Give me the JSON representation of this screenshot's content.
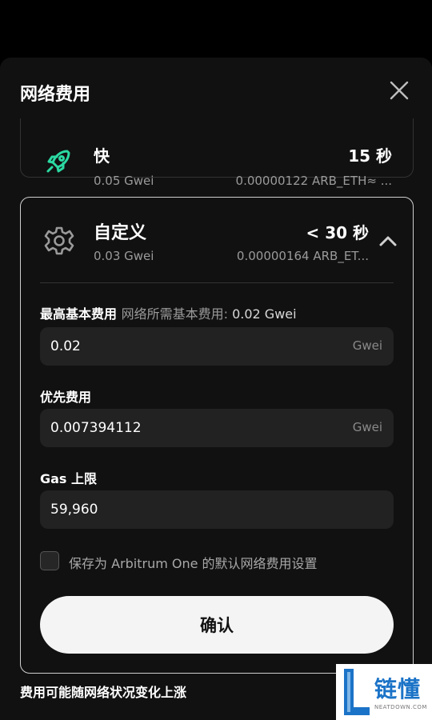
{
  "header": {
    "title": "网络费用"
  },
  "fast_option": {
    "name": "快",
    "time": "15 秒",
    "gwei": "0.05 Gwei",
    "amount": "0.00000122 ARB_ETH≈ ...",
    "icon": "rocket-icon",
    "icon_color": "#2bd9a2"
  },
  "custom_option": {
    "name": "自定义",
    "time": "< 30 秒",
    "gwei": "0.03 Gwei",
    "amount": "0.00000164 ARB_ET...",
    "icon": "gear-icon",
    "expanded": true,
    "max_base_fee": {
      "label": "最高基本费用",
      "hint": "网络所需基本费用:",
      "hint_value": "0.02 Gwei",
      "value": "0.02",
      "unit": "Gwei"
    },
    "priority_fee": {
      "label": "优先费用",
      "value": "0.007394112",
      "unit": "Gwei"
    },
    "gas_limit": {
      "label": "Gas 上限",
      "value": "59,960"
    },
    "save_default_label": "保存为 Arbitrum One 的默认网络费用设置",
    "save_default_checked": false,
    "confirm_label": "确认"
  },
  "footer_note": "费用可能随网络状况变化上涨",
  "watermark": {
    "text": "链懂",
    "sub": "NEATDOWN.COM",
    "color": "#1b73c7"
  }
}
